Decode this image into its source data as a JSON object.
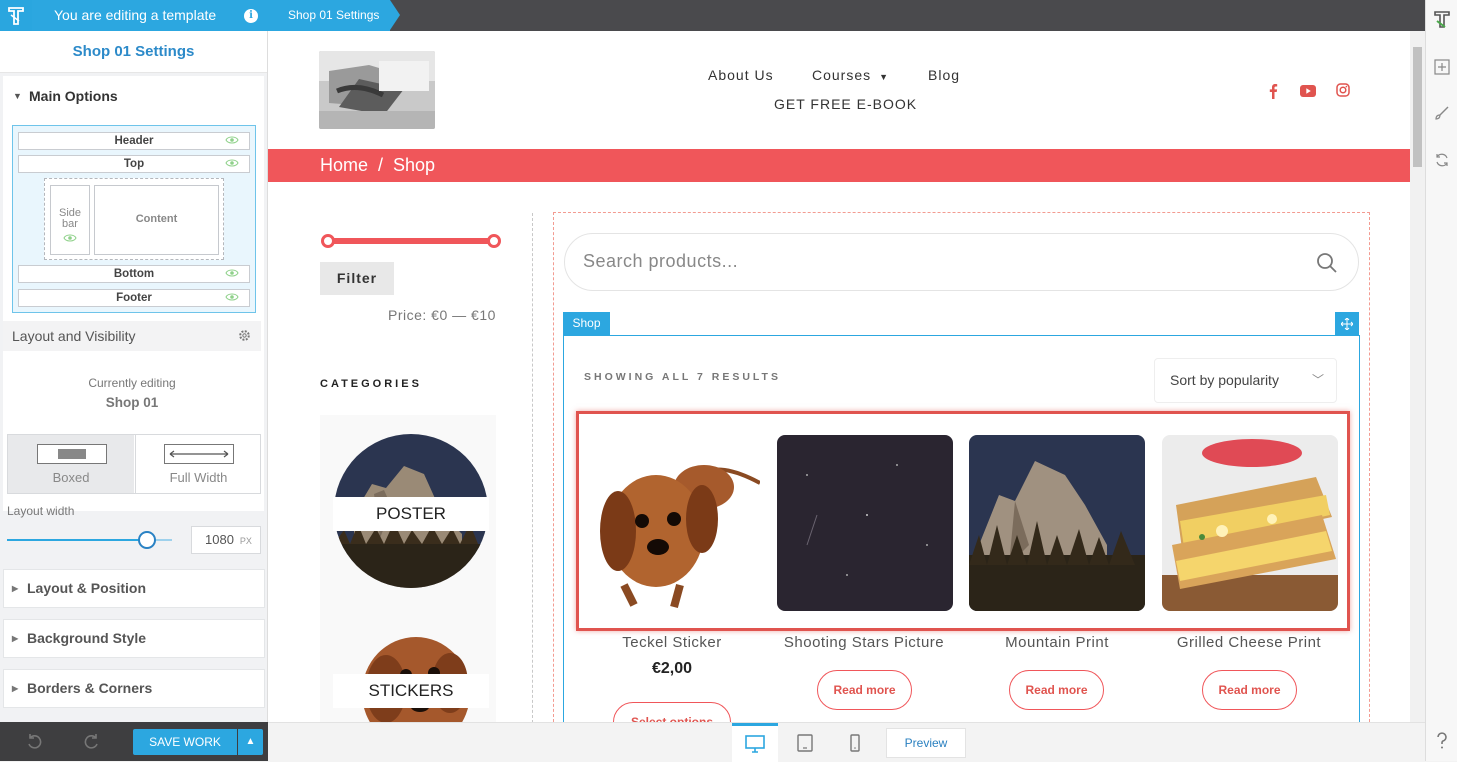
{
  "topbar": {
    "banner": "You are editing a template",
    "crumb": "Shop 01 Settings"
  },
  "panel": {
    "title": "Shop 01 Settings",
    "main_options": "Main Options",
    "layout": {
      "header": "Header",
      "top": "Top",
      "sidebar_line1": "Side",
      "sidebar_line2": "bar",
      "content": "Content",
      "bottom": "Bottom",
      "footer": "Footer"
    },
    "layout_visibility": "Layout and Visibility",
    "currently_editing": "Currently editing",
    "current_name": "Shop 01",
    "boxed": "Boxed",
    "full_width": "Full Width",
    "layout_width_label": "Layout width",
    "layout_width_value": "1080",
    "layout_width_unit": "PX",
    "layout_width_fraction": 0.85,
    "sections": [
      "Layout & Position",
      "Background Style",
      "Borders & Corners"
    ]
  },
  "bottombar": {
    "save": "SAVE WORK",
    "preview": "Preview"
  },
  "site": {
    "nav": {
      "about": "About Us",
      "courses": "Courses",
      "blog": "Blog",
      "ebook": "GET FREE E-BOOK"
    },
    "breadcrumb": "Home  /  Shop",
    "filter_button": "Filter",
    "price_label": "Price: €0 — €10",
    "categories_title": "CATEGORIES",
    "categories": [
      "POSTER",
      "STICKERS"
    ],
    "search_placeholder": "Search products...",
    "shop_tag": "Shop",
    "results_text": "SHOWING ALL 7 RESULTS",
    "sort_label": "Sort by popularity",
    "products": [
      {
        "name": "Teckel Sticker",
        "price": "€2,00",
        "button": "Select options"
      },
      {
        "name": "Shooting Stars Picture",
        "button": "Read more"
      },
      {
        "name": "Mountain Print",
        "button": "Read more"
      },
      {
        "name": "Grilled Cheese Print",
        "button": "Read more"
      }
    ]
  },
  "colors": {
    "accent": "#2ca7e0",
    "brand_red": "#f0565a",
    "dark_bar": "#4a4a4d"
  }
}
